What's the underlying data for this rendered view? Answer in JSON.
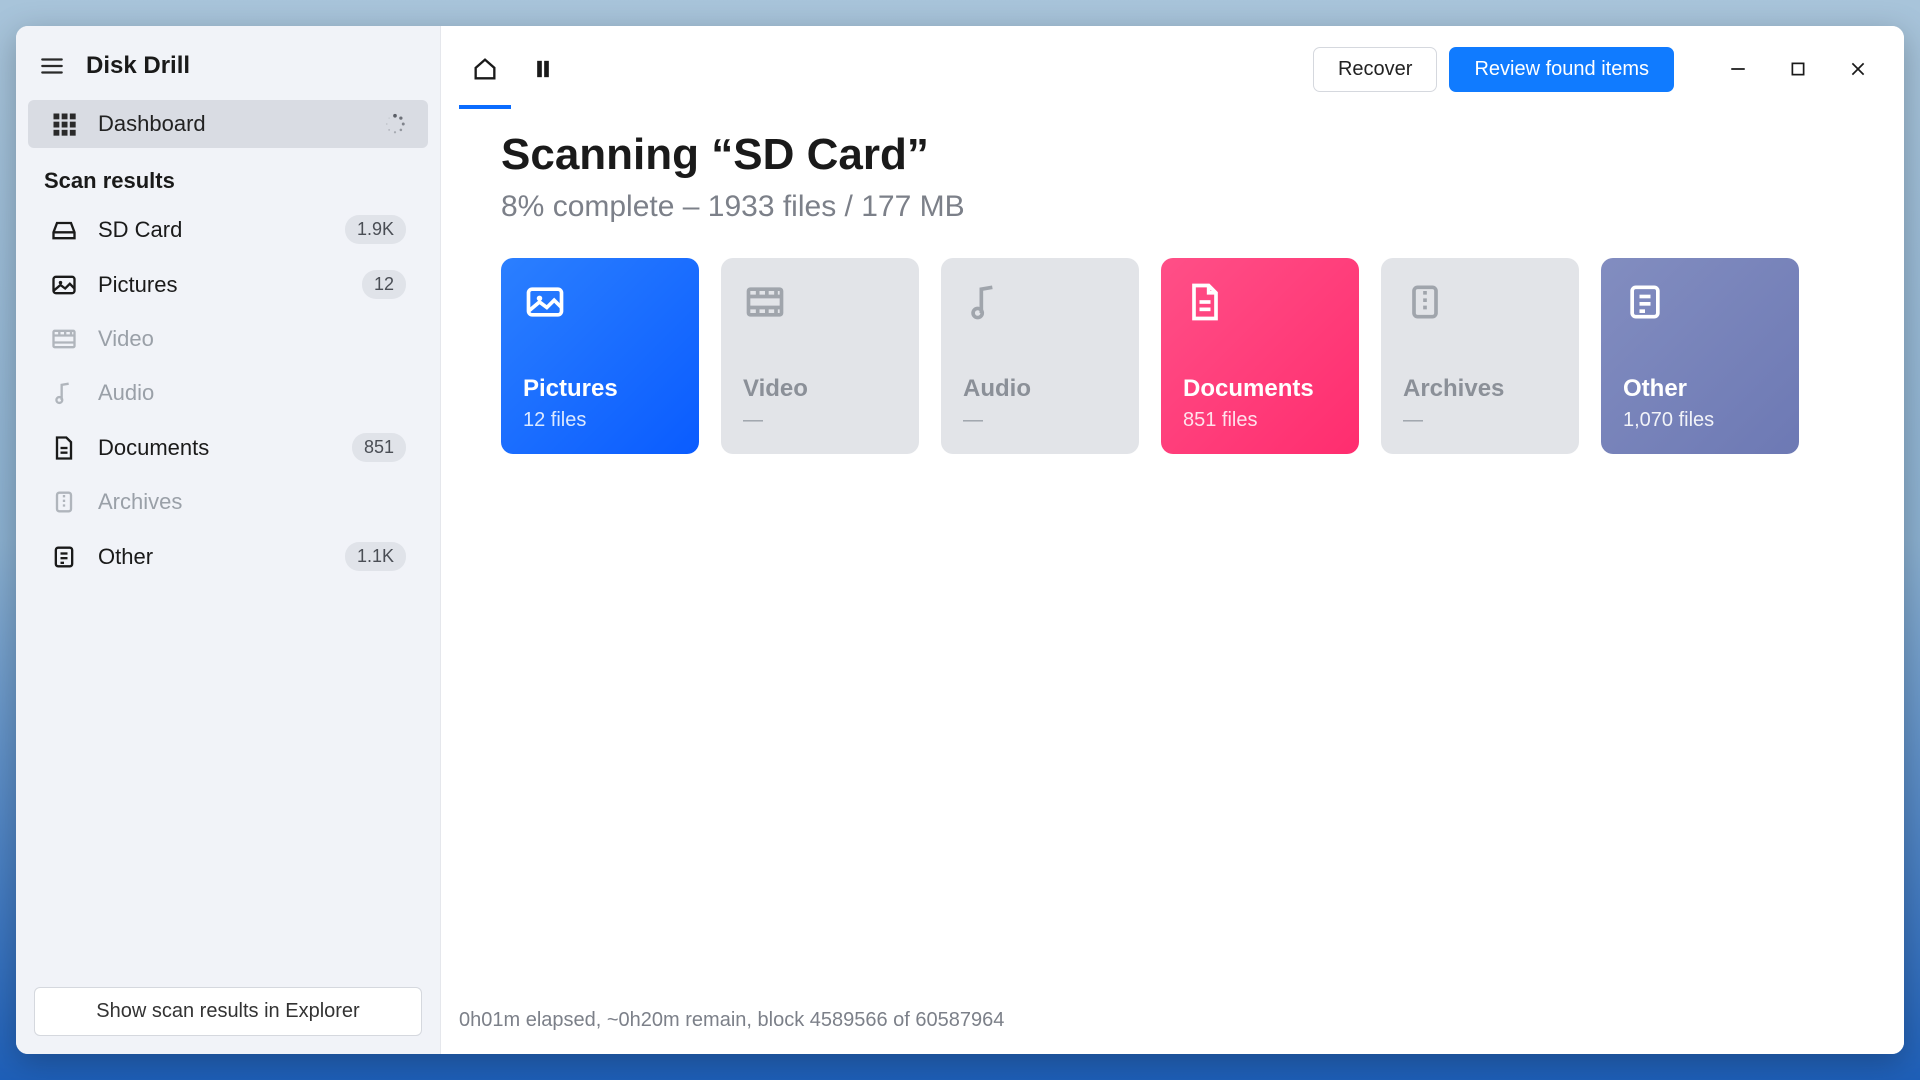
{
  "app": {
    "title": "Disk Drill"
  },
  "sidebar": {
    "dashboard": "Dashboard",
    "section": "Scan results",
    "items": [
      {
        "label": "SD Card",
        "badge": "1.9K",
        "has_data": true
      },
      {
        "label": "Pictures",
        "badge": "12",
        "has_data": true
      },
      {
        "label": "Video",
        "badge": "",
        "has_data": false
      },
      {
        "label": "Audio",
        "badge": "",
        "has_data": false
      },
      {
        "label": "Documents",
        "badge": "851",
        "has_data": true
      },
      {
        "label": "Archives",
        "badge": "",
        "has_data": false
      },
      {
        "label": "Other",
        "badge": "1.1K",
        "has_data": true
      }
    ],
    "footer_button": "Show scan results in Explorer"
  },
  "toolbar": {
    "recover": "Recover",
    "review": "Review found items"
  },
  "main": {
    "title": "Scanning “SD Card”",
    "subtitle": "8% complete – 1933 files / 177 MB",
    "cards": [
      {
        "title": "Pictures",
        "sub": "12 files"
      },
      {
        "title": "Video",
        "sub": "—"
      },
      {
        "title": "Audio",
        "sub": "—"
      },
      {
        "title": "Documents",
        "sub": "851 files"
      },
      {
        "title": "Archives",
        "sub": "—"
      },
      {
        "title": "Other",
        "sub": "1,070 files"
      }
    ],
    "status": "0h01m elapsed, ~0h20m remain, block 4589566 of 60587964"
  }
}
